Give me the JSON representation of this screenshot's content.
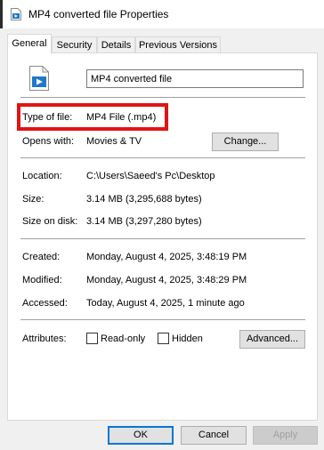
{
  "window": {
    "title": "MP4 converted file Properties",
    "icon": "video-file-icon"
  },
  "tabs": [
    {
      "label": "General",
      "active": true
    },
    {
      "label": "Security",
      "active": false
    },
    {
      "label": "Details",
      "active": false
    },
    {
      "label": "Previous Versions",
      "active": false
    }
  ],
  "general": {
    "file_icon": "video-file-icon",
    "file_name": "MP4 converted file",
    "type_label": "Type of file:",
    "type_value": "MP4 File (.mp4)",
    "opens_label": "Opens with:",
    "opens_value": "Movies & TV",
    "change_button": "Change...",
    "location_label": "Location:",
    "location_value": "C:\\Users\\Saeed's Pc\\Desktop",
    "size_label": "Size:",
    "size_value": "3.14 MB (3,295,688 bytes)",
    "size_on_disk_label": "Size on disk:",
    "size_on_disk_value": "3.14 MB (3,297,280 bytes)",
    "created_label": "Created:",
    "created_value": "Monday, August 4, 2025, 3:48:19 PM",
    "modified_label": "Modified:",
    "modified_value": "Monday, August 4, 2025, 3:48:29 PM",
    "accessed_label": "Accessed:",
    "accessed_value": "Today, August 4, 2025, 1 minute ago",
    "attributes_label": "Attributes:",
    "readonly_label": "Read-only",
    "readonly_checked": false,
    "hidden_label": "Hidden",
    "hidden_checked": false,
    "advanced_button": "Advanced..."
  },
  "footer": {
    "ok": "OK",
    "cancel": "Cancel",
    "apply": "Apply"
  },
  "colors": {
    "highlight": "#e01414",
    "accent": "#0078d7"
  }
}
